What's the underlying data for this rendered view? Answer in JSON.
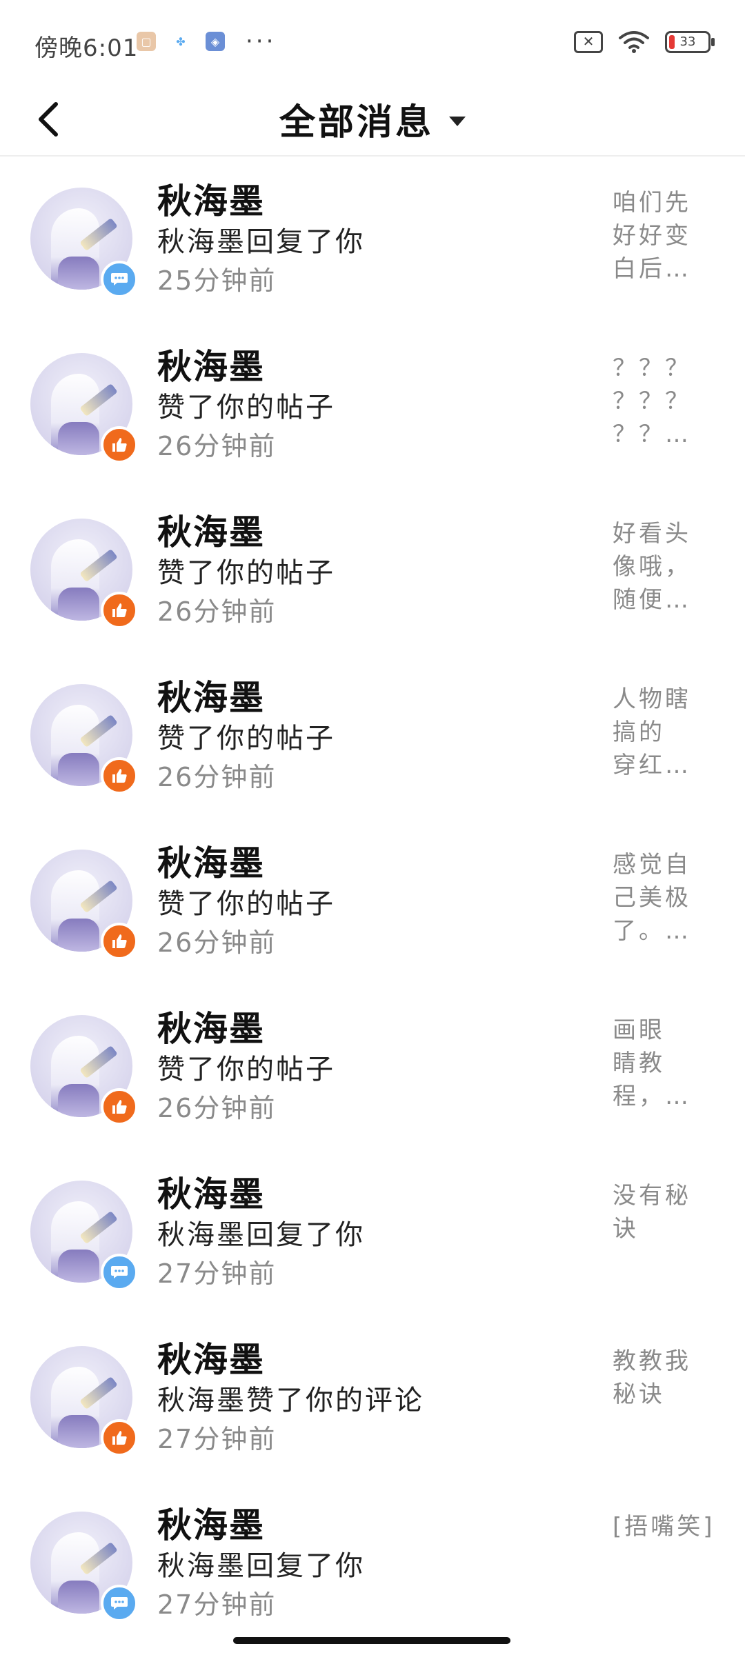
{
  "status_bar": {
    "time": "傍晚6:01",
    "left_icons": [
      "app-icon-orange",
      "app-icon-blue",
      "app-icon-multicolor"
    ],
    "more": "···",
    "battery": "33"
  },
  "header": {
    "title": "全部消息"
  },
  "messages": [
    {
      "name": "秋海墨",
      "action": "秋海墨回复了你",
      "time": "25分钟前",
      "badge": "comment",
      "preview": "咱们先\n好好变\n白后…"
    },
    {
      "name": "秋海墨",
      "action": "赞了你的帖子",
      "time": "26分钟前",
      "badge": "like",
      "preview": "？？？\n？？？\n？？…"
    },
    {
      "name": "秋海墨",
      "action": "赞了你的帖子",
      "time": "26分钟前",
      "badge": "like",
      "preview": "好看头\n像哦，\n随便…"
    },
    {
      "name": "秋海墨",
      "action": "赞了你的帖子",
      "time": "26分钟前",
      "badge": "like",
      "preview": "人物瞎\n搞的\n穿红…"
    },
    {
      "name": "秋海墨",
      "action": "赞了你的帖子",
      "time": "26分钟前",
      "badge": "like",
      "preview": "感觉自\n己美极\n了。…"
    },
    {
      "name": "秋海墨",
      "action": "赞了你的帖子",
      "time": "26分钟前",
      "badge": "like",
      "preview": "画眼\n睛教\n程，…"
    },
    {
      "name": "秋海墨",
      "action": "秋海墨回复了你",
      "time": "27分钟前",
      "badge": "comment",
      "preview": "没有秘\n诀"
    },
    {
      "name": "秋海墨",
      "action": "秋海墨赞了你的评论",
      "time": "27分钟前",
      "badge": "like",
      "preview": "教教我\n秘诀"
    },
    {
      "name": "秋海墨",
      "action": "秋海墨回复了你",
      "time": "27分钟前",
      "badge": "comment",
      "preview": "[捂嘴笑]"
    }
  ],
  "colors": {
    "like_badge": "#f06a1c",
    "comment_badge": "#5aaaf0",
    "secondary_text": "#8a8a8a"
  }
}
